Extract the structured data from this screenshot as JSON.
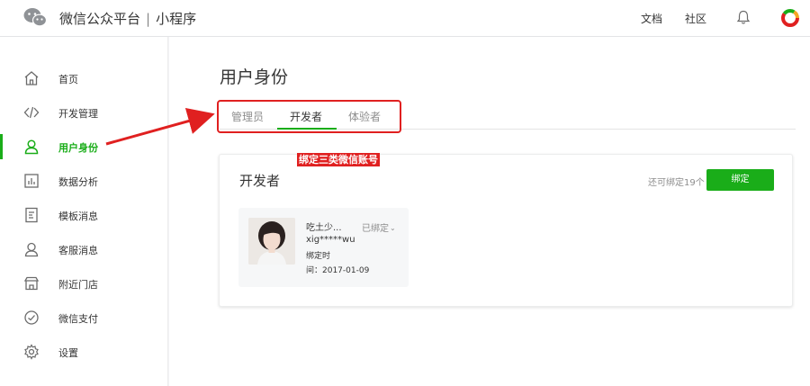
{
  "header": {
    "brand": "微信公众平台",
    "separator": "|",
    "product": "小程序",
    "links": [
      {
        "label": "文档"
      },
      {
        "label": "社区"
      }
    ]
  },
  "sidebar": {
    "items": [
      {
        "label": "首页",
        "icon": "home-icon"
      },
      {
        "label": "开发管理",
        "icon": "code-icon"
      },
      {
        "label": "用户身份",
        "icon": "user-icon",
        "active": true
      },
      {
        "label": "数据分析",
        "icon": "chart-icon"
      },
      {
        "label": "模板消息",
        "icon": "document-icon"
      },
      {
        "label": "客服消息",
        "icon": "customer-service-icon"
      },
      {
        "label": "附近门店",
        "icon": "store-icon"
      },
      {
        "label": "微信支付",
        "icon": "payment-icon"
      },
      {
        "label": "设置",
        "icon": "gear-icon"
      }
    ]
  },
  "main": {
    "title": "用户身份",
    "tabs": [
      {
        "label": "管理员"
      },
      {
        "label": "开发者",
        "active": true
      },
      {
        "label": "体验者"
      }
    ],
    "annotation": "绑定三类微信账号",
    "card": {
      "title": "开发者",
      "quota_text": "还可绑定19个",
      "bind_button": "绑定",
      "member": {
        "name": "吃土少...",
        "status": "已绑定",
        "account": "xig*****wu",
        "bind_time_label": "绑定时",
        "bind_date": "间：2017-01-09"
      }
    }
  },
  "colors": {
    "accent": "#1aad19",
    "annotation_red": "#e02020"
  }
}
